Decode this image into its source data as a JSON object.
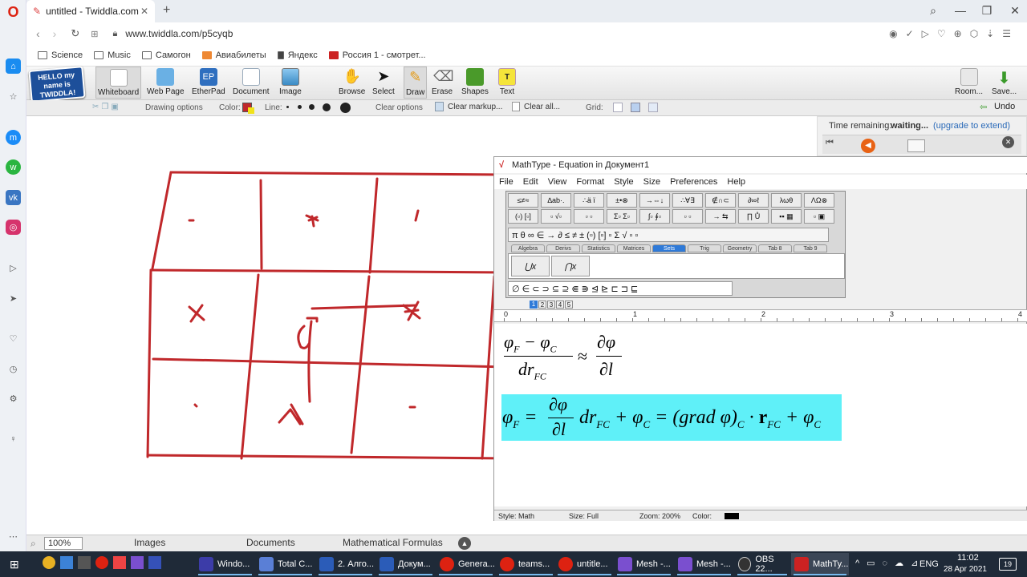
{
  "browser": {
    "tab_title": "untitled - Twiddla.com",
    "url": "www.twiddla.com/p5cyqb",
    "bookmarks": [
      "Science",
      "Music",
      "Самогон",
      "Авиабилеты",
      "Яндекс",
      "Россия 1 - смотрет..."
    ]
  },
  "twiddla": {
    "logo": "HELLO my name is TWIDDLA!",
    "tools": [
      "Whiteboard",
      "Web Page",
      "EtherPad",
      "Document",
      "Image",
      "Browse",
      "Select",
      "Draw",
      "Erase",
      "Shapes",
      "Text"
    ],
    "right_tools": [
      "Room...",
      "Save..."
    ],
    "undo": "Undo",
    "drawing_options": "Drawing options",
    "color_label": "Color:",
    "line_label": "Line:",
    "clear_options": "Clear options",
    "clear_markup": "Clear markup...",
    "clear_all": "Clear all...",
    "grid_label": "Grid:",
    "time_remaining_label": "Time remaining:",
    "time_remaining_value": "waiting...",
    "upgrade_link": "(upgrade to extend)",
    "colors": {
      "draw_red": "#c0282b",
      "accent_green": "#4a9a2a"
    }
  },
  "mathtype": {
    "title": "MathType - Equation in Документ1",
    "menu": [
      "File",
      "Edit",
      "View",
      "Format",
      "Style",
      "Size",
      "Preferences",
      "Help"
    ],
    "palette_tabs": [
      "Algebra",
      "Derivs",
      "Statistics",
      "Matrices",
      "Sets",
      "Trig",
      "Geometry",
      "Tab 8",
      "Tab 9"
    ],
    "active_tab": "Sets",
    "ruler_ticks": [
      "0",
      "1",
      "2",
      "3",
      "4"
    ],
    "status": {
      "style": "Style: Math",
      "size": "Size: Full",
      "zoom": "Zoom: 200%",
      "color": "Color:"
    },
    "highlight_color": "#5ff0f8"
  },
  "bottom_tabs": {
    "zoom": "100%",
    "images": "Images",
    "documents": "Documents",
    "formulas": "Mathematical Formulas"
  },
  "taskbar": {
    "items": [
      "Windo...",
      "Total C...",
      "2. Алго...",
      "Докум...",
      "Genera...",
      "teams...",
      "untitle...",
      "Mesh -...",
      "Mesh -...",
      "OBS 22...",
      "MathTy..."
    ],
    "lang": "ENG",
    "time": "11:02",
    "date": "28 Apr 2021",
    "notif": "19"
  }
}
